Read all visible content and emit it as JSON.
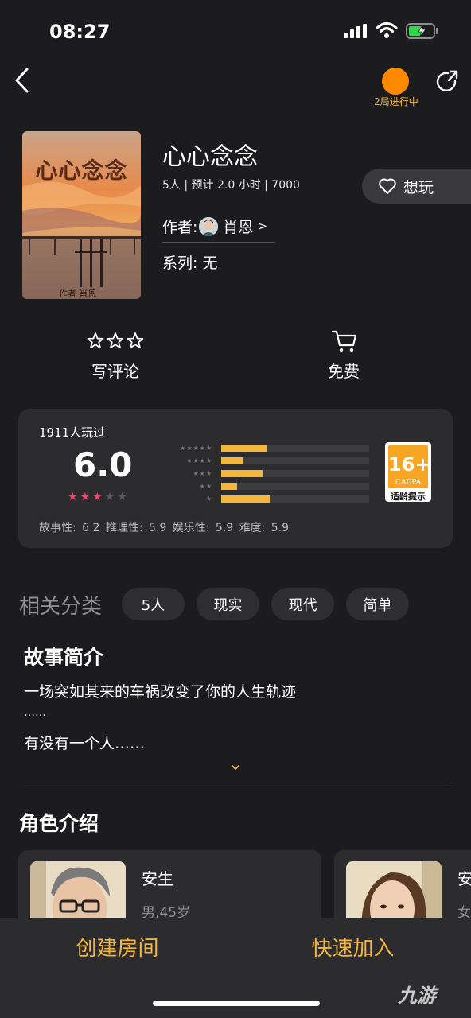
{
  "status_bar": {
    "time": "08:27"
  },
  "header": {
    "progress_label": "2局进行中",
    "accent": "#ff8a00"
  },
  "game": {
    "cover_title": "心心念念",
    "cover_author": "作者  肖恩",
    "title": "心心念念",
    "meta": "5人 | 预计 2.0 小时 | 7000",
    "want_label": "想玩",
    "author_label": "作者:",
    "author_name": "肖恩",
    "author_chevron": ">",
    "series": "系列: 无"
  },
  "actions": {
    "review_label": "写评论",
    "price_label": "免费"
  },
  "rating": {
    "played": "1911人玩过",
    "score": "6.0",
    "score_stars_filled": 3,
    "score_stars_total": 5,
    "distribution": [
      {
        "stars": "★★★★★",
        "fraction": 0.31
      },
      {
        "stars": "★★★★",
        "fraction": 0.15
      },
      {
        "stars": "★★★",
        "fraction": 0.28
      },
      {
        "stars": "★★",
        "fraction": 0.11
      },
      {
        "stars": "★",
        "fraction": 0.33
      }
    ],
    "age_rating": "16+",
    "age_org": "CADPA",
    "age_label": "适龄提示",
    "sub_scores": "故事性: 6.2  推理性: 5.9  娱乐性: 5.9  难度: 5.9"
  },
  "tags": {
    "title": "相关分类",
    "items": [
      "5人",
      "现实",
      "现代",
      "简单"
    ]
  },
  "story": {
    "title": "故事简介",
    "lines": [
      "一场突如其来的车祸改变了你的人生轨迹",
      "……",
      "有没有一个人……"
    ]
  },
  "characters": {
    "title": "角色介绍",
    "items": [
      {
        "name": "安生",
        "info": "男,45岁"
      },
      {
        "name": "安",
        "info": "女"
      }
    ]
  },
  "bottom": {
    "create_label": "创建房间",
    "quick_label": "快速加入"
  },
  "watermark": "九游",
  "colors": {
    "accent_yellow": "#f4b63a",
    "star_pink": "#f2486e",
    "background": "#1c1c1e"
  }
}
